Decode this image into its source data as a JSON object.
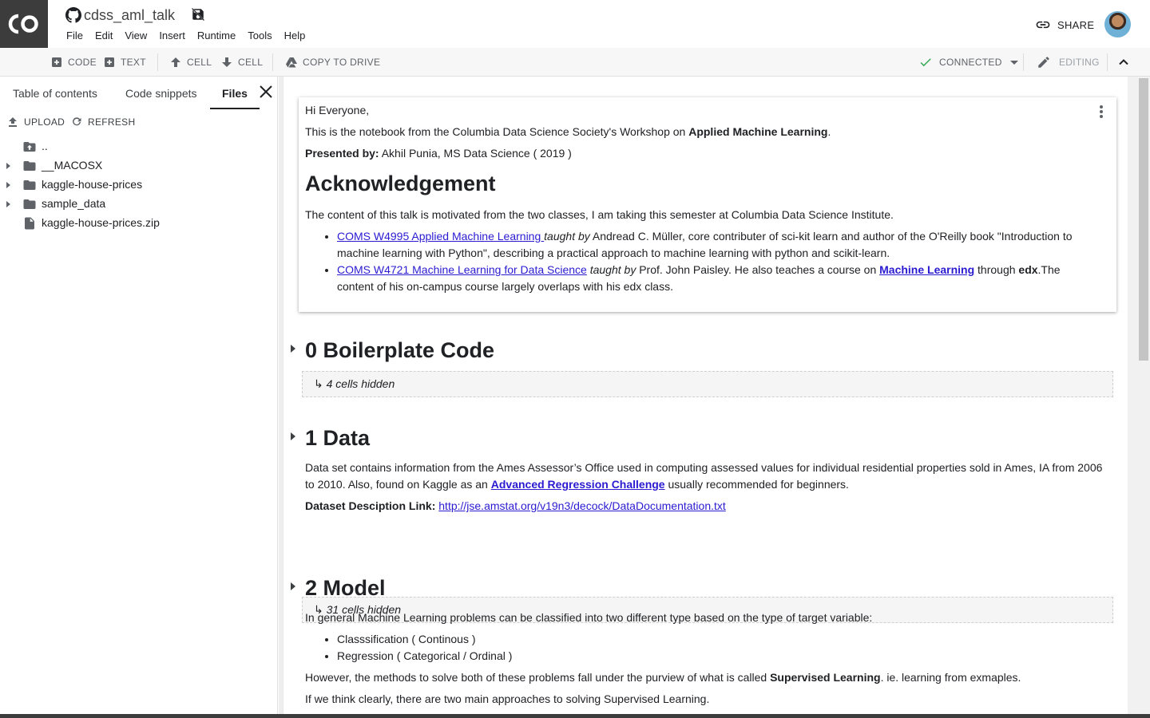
{
  "header": {
    "title": "cdss_aml_talk",
    "menu": [
      "File",
      "Edit",
      "View",
      "Insert",
      "Runtime",
      "Tools",
      "Help"
    ],
    "share_label": "SHARE"
  },
  "toolbar": {
    "code_label": "CODE",
    "text_label": "TEXT",
    "cell_up_label": "CELL",
    "cell_down_label": "CELL",
    "copy_label": "COPY TO DRIVE",
    "connected_label": "CONNECTED",
    "editing_label": "EDITING",
    "connected_color": "#34a853"
  },
  "sidebar": {
    "tabs": [
      "Table of contents",
      "Code snippets",
      "Files"
    ],
    "active_tab": "Files",
    "upload_label": "UPLOAD",
    "refresh_label": "REFRESH",
    "files": [
      {
        "name": "..",
        "type": "parent-folder",
        "expandable": false
      },
      {
        "name": "__MACOSX",
        "type": "folder",
        "expandable": true
      },
      {
        "name": "kaggle-house-prices",
        "type": "folder",
        "expandable": true
      },
      {
        "name": "sample_data",
        "type": "folder",
        "expandable": true
      },
      {
        "name": "kaggle-house-prices.zip",
        "type": "file",
        "expandable": false
      }
    ]
  },
  "cells": {
    "intro": {
      "greeting": "Hi Everyone,",
      "line2_pre": "This is the notebook from the Columbia Data Science Society's Workshop on ",
      "line2_bold": "Applied Machine Learning",
      "line2_post": ".",
      "presented_label": "Presented by:",
      "presented_value": " Akhil Punia, MS Data Science ( 2019 )",
      "heading": "Acknowledgement",
      "ack_text": "The content of this talk is motivated from the two classes, I am taking this semester at Columbia Data Science Institute.",
      "bullet1_link": "COMS W4995 Applied Machine Learning ",
      "bullet1_em": "taught by",
      "bullet1_rest": " Andread C. Müller, core contributer of sci-kit learn and author of the O'Reilly book \"Introduction to machine learning with Python\", describing a practical approach to machine learning with python and scikit-learn.",
      "bullet2_link": "COMS W4721 Machine Learning for Data Science",
      "bullet2_em": "taught by",
      "bullet2_mid": " Prof. John Paisley. He also teaches a course on ",
      "bullet2_link2": "Machine Learning",
      "bullet2_mid2": " through ",
      "bullet2_bold": "edx",
      "bullet2_rest": ".The content of his on-campus course largely overlaps with his edx class."
    },
    "section0": {
      "heading": "0 Boilerplate Code",
      "hidden": "↳ 4 cells hidden"
    },
    "section1": {
      "heading": "1 Data",
      "para_pre": "Data set contains information from the Ames Assessor’s Office used in computing assessed values for individual residential properties sold in Ames, IA from 2006 to 2010. Also, found on Kaggle as an ",
      "para_link": "Advanced Regression Challenge",
      "para_post": " usually recommended for beginners.",
      "link_label": "Dataset Desciption Link:",
      "link_url": "http://jse.amstat.org/v19n3/decock/DataDocumentation.txt",
      "hidden": "↳ 31 cells hidden"
    },
    "section2": {
      "heading": "2 Model",
      "para1": "In general Machine Learning problems can be classified into two different type based on the type of target variable:",
      "bullets": [
        "Classsification ( Continous )",
        "Regression ( Categorical / Ordinal )"
      ],
      "para2_pre": "However, the methods to solve both of these problems fall under the purview of what is called ",
      "para2_bold": "Supervised Learning",
      "para2_post": ". ie. learning from exmaples.",
      "para3": "If we think clearly, there are two main approaches to solving Supervised Learning."
    }
  }
}
